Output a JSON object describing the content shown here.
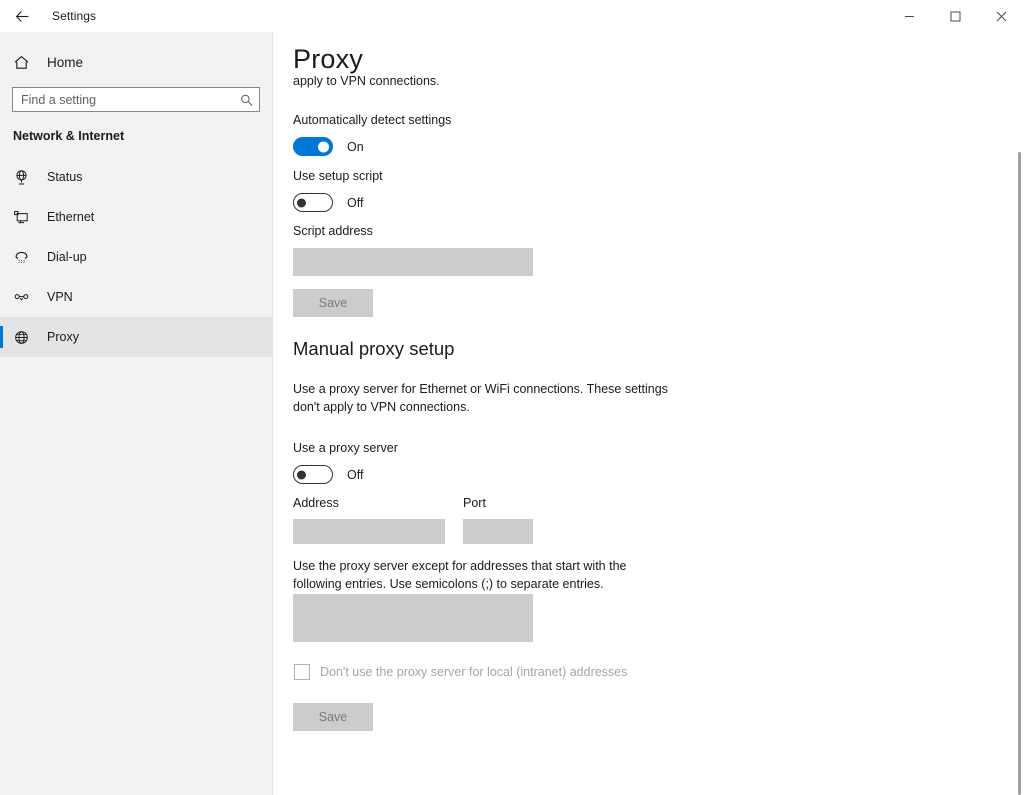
{
  "titlebar": {
    "back_icon": "back-arrow-icon",
    "title": "Settings",
    "minimize_label": "Minimize",
    "maximize_label": "Maximize",
    "close_label": "Close"
  },
  "sidebar": {
    "home": {
      "label": "Home",
      "icon": "home-icon"
    },
    "search": {
      "value": "",
      "placeholder": "Find a setting",
      "icon": "search-icon"
    },
    "section_title": "Network & Internet",
    "items": [
      {
        "label": "Status",
        "icon": "status-globe-icon",
        "selected": false
      },
      {
        "label": "Ethernet",
        "icon": "ethernet-icon",
        "selected": false
      },
      {
        "label": "Dial-up",
        "icon": "dialup-phone-icon",
        "selected": false
      },
      {
        "label": "VPN",
        "icon": "vpn-icon",
        "selected": false
      },
      {
        "label": "Proxy",
        "icon": "proxy-globe-icon",
        "selected": true
      }
    ]
  },
  "main": {
    "page_title": "Proxy",
    "clipped_text": "apply to VPN connections.",
    "auto_detect": {
      "label": "Automatically detect settings",
      "state": "On"
    },
    "setup_script": {
      "label": "Use setup script",
      "state": "Off"
    },
    "script_address": {
      "label": "Script address",
      "value": ""
    },
    "save_top": "Save",
    "manual_section": {
      "heading": "Manual proxy setup",
      "description": "Use a proxy server for Ethernet or WiFi connections. These settings don't apply to VPN connections.",
      "use_proxy": {
        "label": "Use a proxy server",
        "state": "Off"
      },
      "address": {
        "label": "Address",
        "value": ""
      },
      "port": {
        "label": "Port",
        "value": ""
      },
      "exceptions_description": "Use the proxy server except for addresses that start with the following entries. Use semicolons (;) to separate entries.",
      "exceptions": {
        "value": ""
      },
      "bypass_local": {
        "label": "Don't use the proxy server for local (intranet) addresses",
        "checked": false
      },
      "save_bottom": "Save"
    }
  },
  "colors": {
    "accent": "#0078d7",
    "sidebar_bg": "#f2f2f2",
    "disabled_field": "#cccccc"
  }
}
